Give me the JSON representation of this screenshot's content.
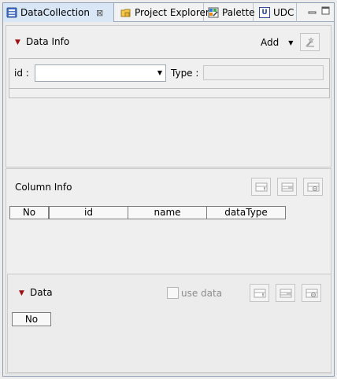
{
  "tabs": [
    {
      "label": "DataCollection",
      "icon": "data-collection-icon",
      "active": true
    },
    {
      "label": "Project Explorer",
      "icon": "folder-icon"
    },
    {
      "label": "Palette",
      "icon": "palette-icon"
    },
    {
      "label": "UDC",
      "icon": "udc-icon",
      "badge": "U"
    }
  ],
  "close_glyph": "⊠",
  "data_info": {
    "title": "Data Info",
    "add_label": "Add",
    "id_label": "id :",
    "type_label": "Type :",
    "id_value": "",
    "type_value": ""
  },
  "column_info": {
    "title": "Column Info",
    "columns": [
      "No",
      "id",
      "name",
      "dataType"
    ]
  },
  "data_section": {
    "title": "Data",
    "use_data_label": "use data",
    "use_data_checked": false,
    "columns": [
      "No"
    ]
  },
  "colors": {
    "active_tab_bg": "#d9e6f6",
    "frame_border": "#8d9eb4",
    "triangle": "#a01010"
  }
}
